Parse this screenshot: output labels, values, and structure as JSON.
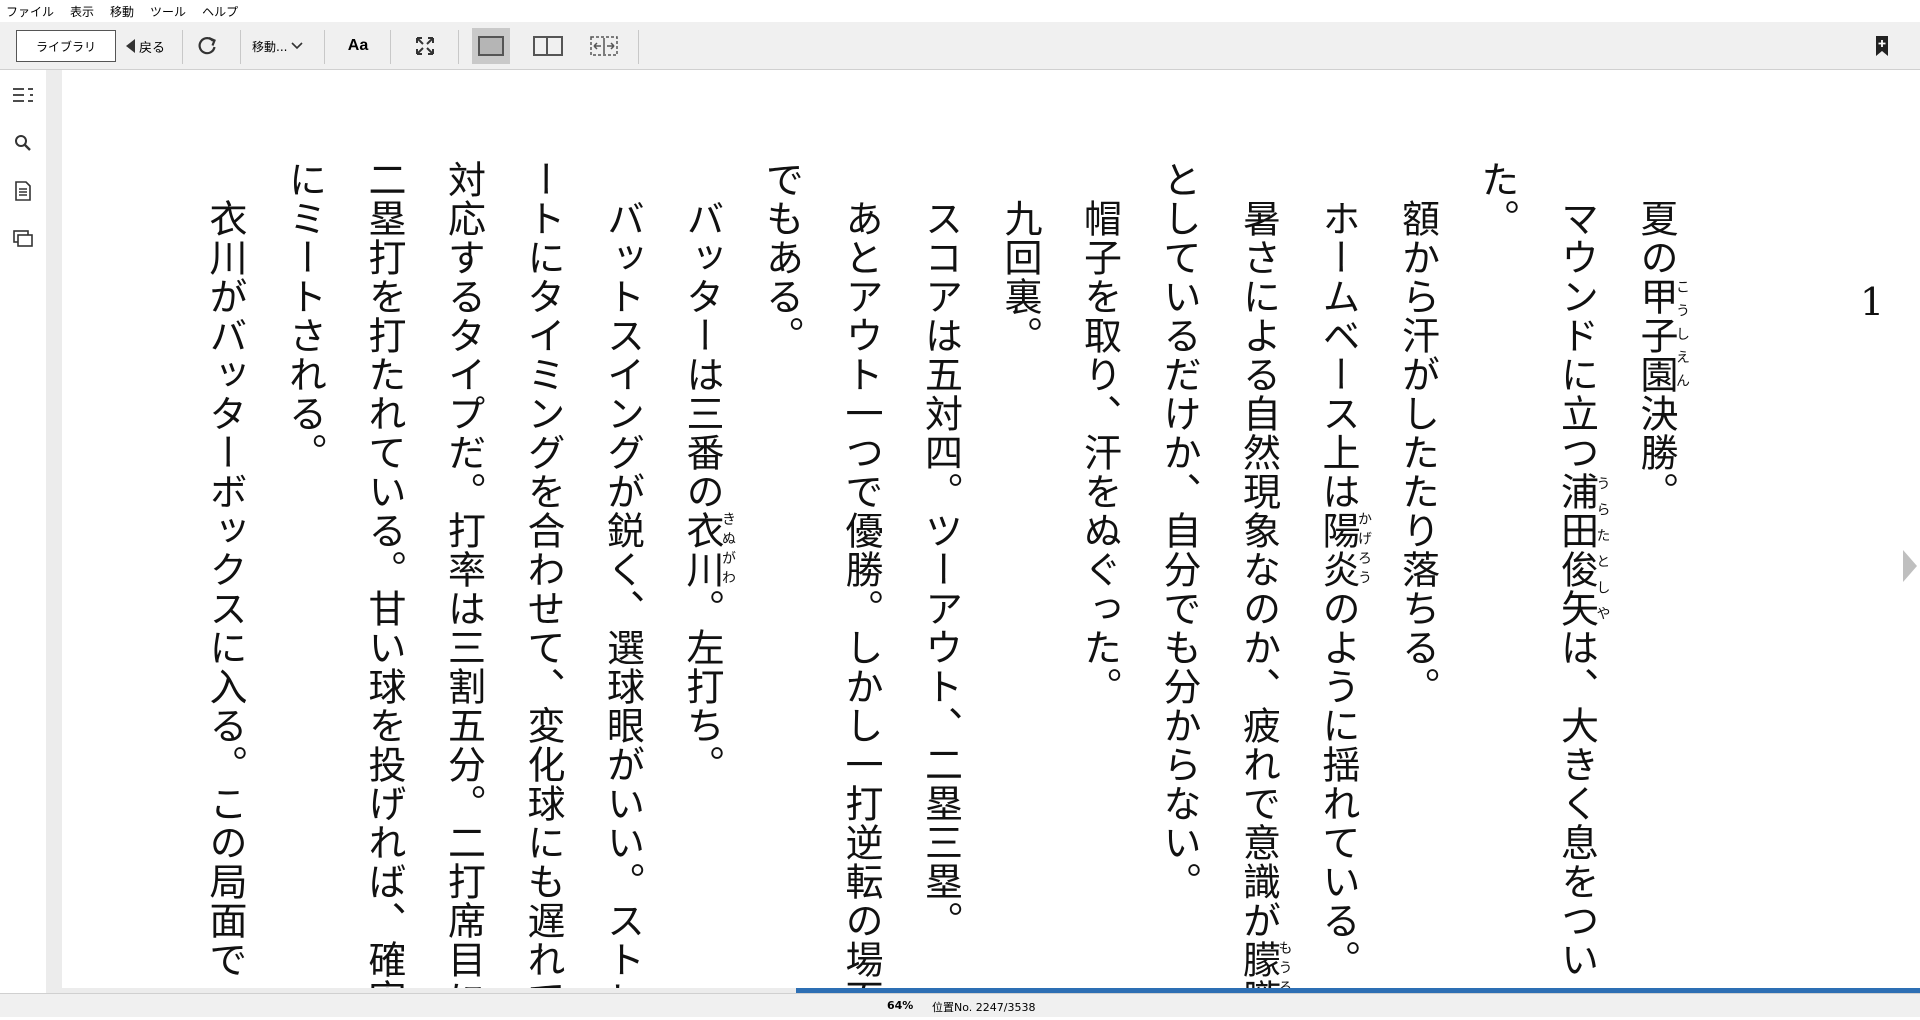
{
  "menu": [
    "ファイル",
    "表示",
    "移動",
    "ツール",
    "ヘルプ"
  ],
  "toolbar": {
    "library_label": "ライブラリ",
    "back_label": "戻る",
    "goto_label": "移動...",
    "font_label": "Aa"
  },
  "page": {
    "number": "1",
    "paragraphs": [
      {
        "pre": "夏の",
        "ruby": [
          {
            "base": "甲子園",
            "rt": "こうしえん"
          }
        ],
        "post": "決勝。"
      },
      {
        "pre": "マウンドに立つ",
        "ruby": [
          {
            "base": "浦田俊矢",
            "rt": "うらたとしや"
          }
        ],
        "post": "は、大きく息をついた。"
      },
      {
        "pre": "額から汗がしたたり落ちる。",
        "ruby": [],
        "post": ""
      },
      {
        "pre": "ホームベース上は",
        "ruby": [
          {
            "base": "陽炎",
            "rt": "かげろう"
          }
        ],
        "post": "のように揺れている。"
      },
      {
        "pre": "暑さによる自然現象なのか、疲れで意識が",
        "ruby": [
          {
            "base": "朦朧",
            "rt": "もうろう"
          }
        ],
        "post": "としているだけか、自分でも分からない。"
      },
      {
        "pre": "帽子を取り、汗をぬぐった。",
        "ruby": [],
        "post": ""
      },
      {
        "pre": "九回裏。",
        "ruby": [],
        "post": ""
      },
      {
        "pre": "スコアは五対四。ツーアウト、二塁三塁。",
        "ruby": [],
        "post": ""
      },
      {
        "pre": "あとアウト一つで優勝。しかし一打逆転の場面でもある。",
        "ruby": [],
        "post": ""
      },
      {
        "pre": "バッターは三番の",
        "ruby": [
          {
            "base": "衣川",
            "rt": "きぬがわ"
          }
        ],
        "post": "。左打ち。"
      },
      {
        "pre": "バットスイングが鋭く、選球眼がいい。ストレートにタイミングを合わせて、変化球にも遅れて対応するタイプだ。打率は三割五分。二打席目に二塁打を打たれている。甘い球を投げれば、確実にミートされる。",
        "ruby": [],
        "post": ""
      },
      {
        "pre": "衣川がバッターボックスに入る。この局面で",
        "ruby": [],
        "post": ""
      }
    ]
  },
  "status": {
    "percent": "64%",
    "location": "位置No. 2247/3538",
    "progress": 0.64
  },
  "colors": {
    "progress": "#2d6fb4",
    "toolbar_bg": "#f0f0f0"
  },
  "icons": [
    "toc-icon",
    "search-icon",
    "notes-icon",
    "flashcards-icon",
    "refresh-icon",
    "fullscreen-icon",
    "bookmark-icon"
  ]
}
